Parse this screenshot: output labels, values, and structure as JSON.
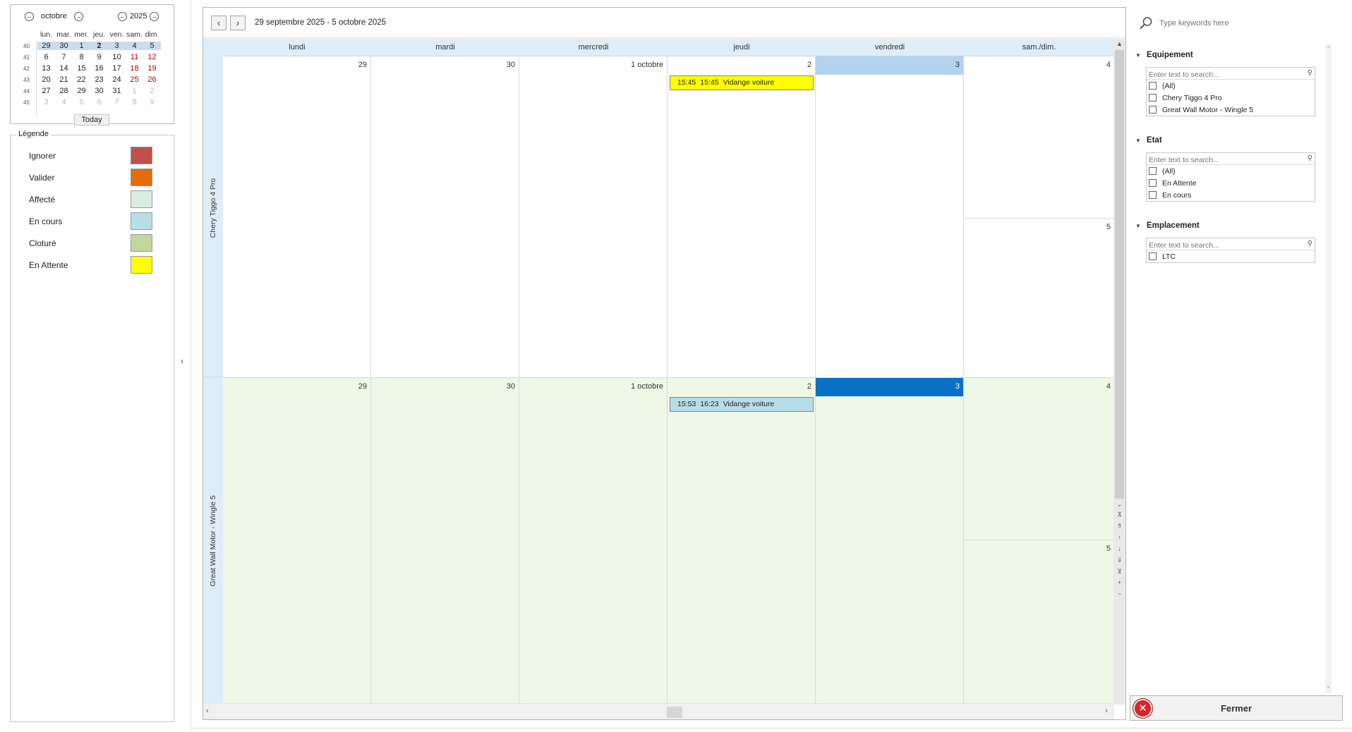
{
  "mini_calendar": {
    "month": "octobre",
    "year": "2025",
    "today_label": "Today",
    "day_headers": [
      "lun.",
      "mar.",
      "mer.",
      "jeu.",
      "ven.",
      "sam.",
      "dim."
    ],
    "weeks": [
      {
        "wk": "40",
        "days": [
          "29",
          "30",
          "1",
          "2",
          "3",
          "4",
          "5"
        ]
      },
      {
        "wk": "41",
        "days": [
          "6",
          "7",
          "8",
          "9",
          "10",
          "11",
          "12"
        ]
      },
      {
        "wk": "42",
        "days": [
          "13",
          "14",
          "15",
          "16",
          "17",
          "18",
          "19"
        ]
      },
      {
        "wk": "43",
        "days": [
          "20",
          "21",
          "22",
          "23",
          "24",
          "25",
          "26"
        ]
      },
      {
        "wk": "44",
        "days": [
          "27",
          "28",
          "29",
          "30",
          "31",
          "1",
          "2"
        ]
      },
      {
        "wk": "45",
        "days": [
          "3",
          "4",
          "5",
          "6",
          "7",
          "8",
          "9"
        ]
      }
    ]
  },
  "legend": {
    "title": "Légende",
    "items": [
      {
        "label": "Ignorer",
        "color": "#c0504d"
      },
      {
        "label": "Valider",
        "color": "#e46c0a"
      },
      {
        "label": "Affecté",
        "color": "#d9eee3"
      },
      {
        "label": "En cours",
        "color": "#b7dde8"
      },
      {
        "label": "Cloturé",
        "color": "#c4d79b"
      },
      {
        "label": "En Attente",
        "color": "#ffff00"
      }
    ]
  },
  "scheduler": {
    "range": "29 septembre 2025 - 5 octobre 2025",
    "day_headers": [
      "lundi",
      "mardi",
      "mercredi",
      "jeudi",
      "vendredi",
      "sam./dim."
    ],
    "resources": [
      {
        "name": "Chery Tiggo 4 Pro",
        "day_numbers": [
          "29",
          "30",
          "1 octobre",
          "2",
          "3",
          "4",
          "5"
        ],
        "appointments": [
          {
            "start": "15:45",
            "end": "15:45",
            "title": "Vidange voiture",
            "color": "#ffff00"
          }
        ]
      },
      {
        "name": "Great Wall Motor - Wingle 5",
        "day_numbers": [
          "29",
          "30",
          "1 octobre",
          "2",
          "3",
          "4",
          "5"
        ],
        "appointments": [
          {
            "start": "15:53",
            "end": "16:23",
            "title": "Vidange voiture",
            "color": "#b7dde8"
          }
        ]
      }
    ]
  },
  "right_panel": {
    "keywords_placeholder": "Type keywords here",
    "filters": [
      {
        "title": "Equipement",
        "placeholder": "Enter text to search...",
        "items": [
          "(All)",
          "Chery Tiggo 4 Pro",
          "Great Wall Motor - Wingle 5"
        ]
      },
      {
        "title": "Etat",
        "placeholder": "Enter text to search...",
        "items": [
          "(All)",
          "En Attente",
          "En cours"
        ]
      },
      {
        "title": "Emplacement",
        "placeholder": "Enter text to search...",
        "items": [
          "LTC"
        ]
      }
    ],
    "close_label": "Fermer"
  }
}
